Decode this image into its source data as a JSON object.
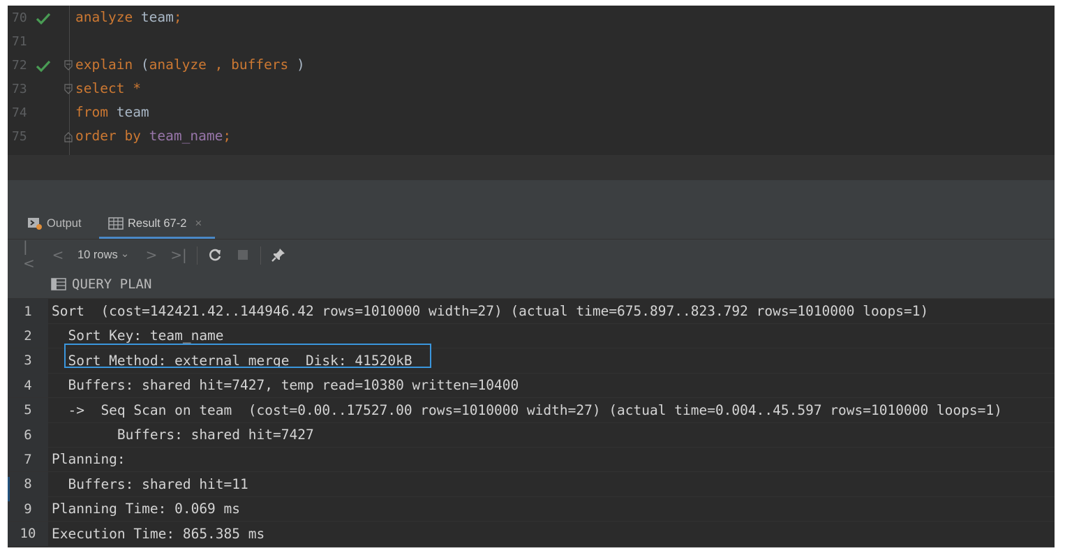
{
  "editor": {
    "lines": [
      {
        "num": "70",
        "status": "check-icon",
        "tokens": [
          {
            "t": "kw",
            "v": "analyze"
          },
          {
            "t": "id",
            "v": " team"
          },
          {
            "t": "op",
            "v": ";"
          }
        ]
      },
      {
        "num": "71",
        "status": "",
        "tokens": []
      },
      {
        "num": "72",
        "status": "check-icon",
        "tokens": [
          {
            "t": "kw",
            "v": "explain"
          },
          {
            "t": "pn",
            "v": " ("
          },
          {
            "t": "kw",
            "v": "analyze"
          },
          {
            "t": "pn",
            "v": " "
          },
          {
            "t": "op",
            "v": ","
          },
          {
            "t": "pn",
            "v": " "
          },
          {
            "t": "kw",
            "v": "buffers"
          },
          {
            "t": "pn",
            "v": " )"
          }
        ]
      },
      {
        "num": "73",
        "status": "",
        "tokens": [
          {
            "t": "kw",
            "v": "select"
          },
          {
            "t": "pn",
            "v": " "
          },
          {
            "t": "op",
            "v": "*"
          }
        ]
      },
      {
        "num": "74",
        "status": "",
        "tokens": [
          {
            "t": "kw",
            "v": "from"
          },
          {
            "t": "id",
            "v": " team"
          }
        ]
      },
      {
        "num": "75",
        "status": "",
        "tokens": [
          {
            "t": "kw",
            "v": "order by"
          },
          {
            "t": "pn",
            "v": " "
          },
          {
            "t": "fld",
            "v": "team_name"
          },
          {
            "t": "op",
            "v": ";"
          }
        ]
      }
    ]
  },
  "tabs": {
    "output_label": "Output",
    "result_label": "Result 67-2",
    "close_glyph": "×"
  },
  "toolbar": {
    "rows_label": "10 rows",
    "first_glyph": "|<",
    "prev_glyph": "<",
    "next_glyph": ">",
    "last_glyph": ">|",
    "chevron_glyph": "⌄"
  },
  "grid": {
    "column_header": "QUERY PLAN",
    "rows": [
      {
        "n": "1",
        "text": "Sort  (cost=142421.42..144946.42 rows=1010000 width=27) (actual time=675.897..823.792 rows=1010000 loops=1)"
      },
      {
        "n": "2",
        "text": "  Sort Key: team_name"
      },
      {
        "n": "3",
        "text": "  Sort Method: external merge  Disk: 41520kB"
      },
      {
        "n": "4",
        "text": "  Buffers: shared hit=7427, temp read=10380 written=10400"
      },
      {
        "n": "5",
        "text": "  ->  Seq Scan on team  (cost=0.00..17527.00 rows=1010000 width=27) (actual time=0.004..45.597 rows=1010000 loops=1)"
      },
      {
        "n": "6",
        "text": "        Buffers: shared hit=7427"
      },
      {
        "n": "7",
        "text": "Planning:"
      },
      {
        "n": "8",
        "text": "  Buffers: shared hit=11"
      },
      {
        "n": "9",
        "text": "Planning Time: 0.069 ms"
      },
      {
        "n": "10",
        "text": "Execution Time: 865.385 ms"
      }
    ]
  },
  "colors": {
    "keyword": "#cc7832",
    "field": "#9876aa",
    "identifier": "#a9b7c6",
    "check": "#499c54",
    "highlight": "#3a96dd",
    "tab_accent": "#4a88c7"
  }
}
